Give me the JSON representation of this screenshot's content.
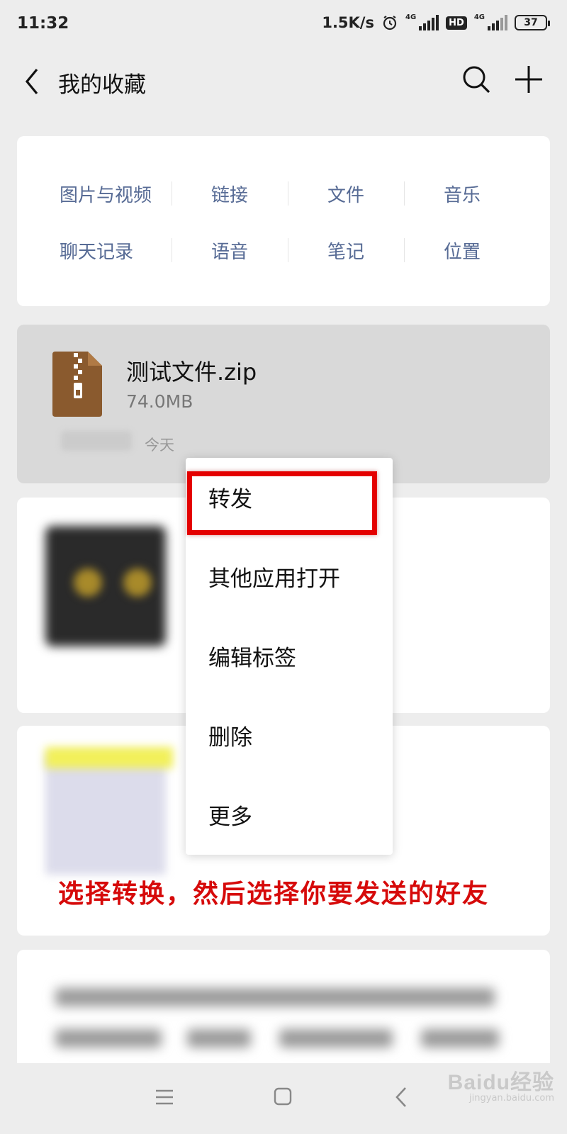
{
  "status_bar": {
    "time": "11:32",
    "network_speed": "1.5K/s",
    "signal_label_1": "4G",
    "hd_label": "HD",
    "signal_label_2": "4G",
    "battery": "37",
    "icons": [
      "alarm-icon",
      "signal-icon",
      "hd-icon",
      "signal-icon",
      "battery-icon"
    ]
  },
  "header": {
    "title": "我的收藏",
    "icons": [
      "back-icon",
      "search-icon",
      "add-icon"
    ]
  },
  "categories": {
    "row1": [
      "图片与视频",
      "链接",
      "文件",
      "音乐"
    ],
    "row2": [
      "聊天记录",
      "语音",
      "笔记",
      "位置"
    ]
  },
  "file_item": {
    "name": "测试文件.zip",
    "size": "74.0MB",
    "date": "今天",
    "icon": "zip-file-icon"
  },
  "context_menu": {
    "items": [
      "转发",
      "其他应用打开",
      "编辑标签",
      "删除",
      "更多"
    ],
    "highlighted_item": "转发",
    "highlight_color": "#e40000"
  },
  "annotation": {
    "text": "选择转换，然后选择你要发送的好友",
    "color": "#d60a0a"
  },
  "nav_bar": {
    "icons": [
      "menu-icon",
      "home-icon",
      "back-icon"
    ]
  },
  "watermark": {
    "brand": "Baidu经验",
    "url": "jingyan.baidu.com"
  },
  "colors": {
    "background": "#ededed",
    "category_text": "#576b95",
    "selected_item_bg": "#d9d9d9"
  }
}
